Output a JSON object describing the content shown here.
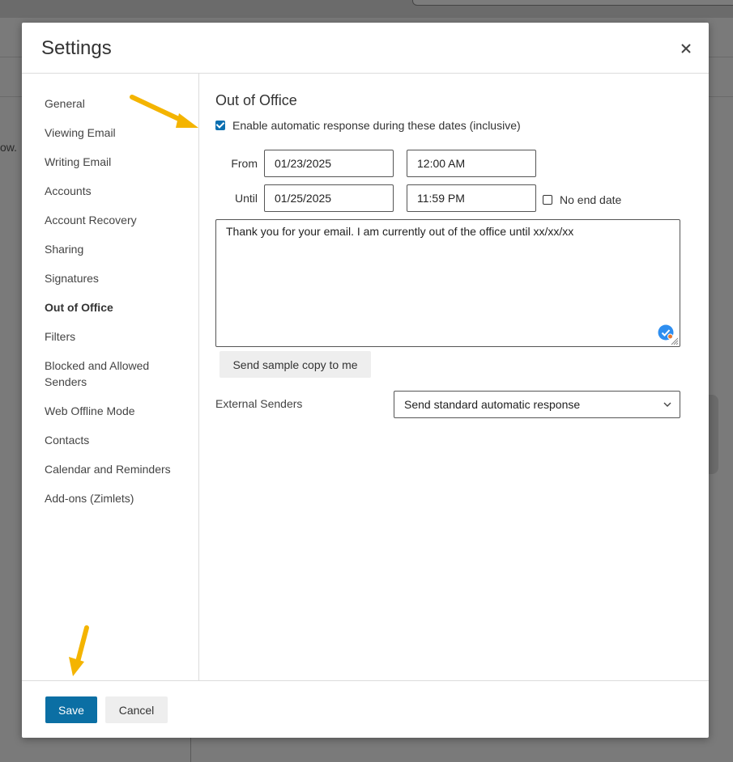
{
  "background": {
    "partial_text": "ow."
  },
  "dialog": {
    "title": "Settings",
    "close_icon": "close-icon"
  },
  "sidebar": {
    "items": [
      {
        "label": "General",
        "active": false
      },
      {
        "label": "Viewing Email",
        "active": false
      },
      {
        "label": "Writing Email",
        "active": false
      },
      {
        "label": "Accounts",
        "active": false
      },
      {
        "label": "Account Recovery",
        "active": false
      },
      {
        "label": "Sharing",
        "active": false
      },
      {
        "label": "Signatures",
        "active": false
      },
      {
        "label": "Out of Office",
        "active": true
      },
      {
        "label": "Filters",
        "active": false
      },
      {
        "label": "Blocked and Allowed Senders",
        "active": false
      },
      {
        "label": "Web Offline Mode",
        "active": false
      },
      {
        "label": "Contacts",
        "active": false
      },
      {
        "label": "Calendar and Reminders",
        "active": false
      },
      {
        "label": "Add-ons (Zimlets)",
        "active": false
      }
    ]
  },
  "out_of_office": {
    "title": "Out of Office",
    "enable_label": "Enable automatic response during these dates (inclusive)",
    "enable_checked": true,
    "from_label": "From",
    "from_date": "01/23/2025",
    "from_time": "12:00 AM",
    "until_label": "Until",
    "until_date": "01/25/2025",
    "until_time": "11:59 PM",
    "no_end_date_label": "No end date",
    "no_end_date_checked": false,
    "message": "Thank you for your email. I am currently out of the office until xx/xx/xx",
    "sample_button": "Send sample copy to me",
    "external_senders_label": "External Senders",
    "external_senders_value": "Send standard automatic response"
  },
  "footer": {
    "save_label": "Save",
    "cancel_label": "Cancel"
  },
  "colors": {
    "primary": "#0b6fa4",
    "annotation_arrow": "#f4b400",
    "overlay": "#7a7a7a"
  }
}
